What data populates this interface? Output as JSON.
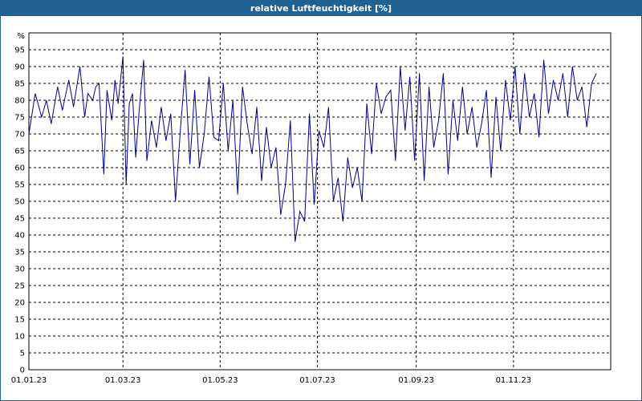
{
  "window": {
    "title": "relative Luftfeuchtigkeit [%]"
  },
  "chart_data": {
    "type": "line",
    "title": "relative Luftfeuchtigkeit [%]",
    "ylabel": "%",
    "ylim": [
      0,
      100
    ],
    "yticks": [
      0,
      5,
      10,
      15,
      20,
      25,
      30,
      35,
      40,
      45,
      50,
      55,
      60,
      65,
      70,
      75,
      80,
      85,
      90,
      95
    ],
    "xlim": [
      "2023-01-01",
      "2024-01-01"
    ],
    "xticks": [
      {
        "date": "2023-01-01",
        "label": "01.01.23"
      },
      {
        "date": "2023-03-01",
        "label": "01.03.23"
      },
      {
        "date": "2023-05-01",
        "label": "01.05.23"
      },
      {
        "date": "2023-07-01",
        "label": "01.07.23"
      },
      {
        "date": "2023-09-01",
        "label": "01.09.23"
      },
      {
        "date": "2023-11-01",
        "label": "01.11.23"
      }
    ],
    "grid": true,
    "line_color": "#00008b",
    "series": [
      {
        "x": [
          "2023-01-01",
          "2023-01-05",
          "2023-01-09",
          "2023-01-12",
          "2023-01-15",
          "2023-01-19",
          "2023-01-22",
          "2023-01-26",
          "2023-01-29",
          "2023-02-02",
          "2023-02-05",
          "2023-02-07",
          "2023-02-10",
          "2023-02-12",
          "2023-02-14",
          "2023-02-17",
          "2023-02-19",
          "2023-02-22",
          "2023-02-24",
          "2023-02-26",
          "2023-03-01",
          "2023-03-03",
          "2023-03-05",
          "2023-03-07",
          "2023-03-09",
          "2023-03-11",
          "2023-03-14",
          "2023-03-16",
          "2023-03-19",
          "2023-03-22",
          "2023-03-25",
          "2023-03-28",
          "2023-03-31",
          "2023-04-03",
          "2023-04-06",
          "2023-04-09",
          "2023-04-12",
          "2023-04-15",
          "2023-04-18",
          "2023-04-21",
          "2023-04-24",
          "2023-04-27",
          "2023-04-30",
          "2023-05-03",
          "2023-05-06",
          "2023-05-09",
          "2023-05-12",
          "2023-05-15",
          "2023-05-18",
          "2023-05-21",
          "2023-05-24",
          "2023-05-27",
          "2023-05-30",
          "2023-06-02",
          "2023-06-05",
          "2023-06-08",
          "2023-06-11",
          "2023-06-14",
          "2023-06-17",
          "2023-06-20",
          "2023-06-23",
          "2023-06-26",
          "2023-06-29",
          "2023-07-02",
          "2023-07-05",
          "2023-07-08",
          "2023-07-11",
          "2023-07-14",
          "2023-07-17",
          "2023-07-20",
          "2023-07-23",
          "2023-07-26",
          "2023-07-29",
          "2023-08-01",
          "2023-08-04",
          "2023-08-07",
          "2023-08-10",
          "2023-08-13",
          "2023-08-16",
          "2023-08-19",
          "2023-08-22",
          "2023-08-25",
          "2023-08-28",
          "2023-08-31",
          "2023-09-03",
          "2023-09-06",
          "2023-09-09",
          "2023-09-12",
          "2023-09-15",
          "2023-09-18",
          "2023-09-21",
          "2023-09-24",
          "2023-09-27",
          "2023-09-30",
          "2023-10-03",
          "2023-10-06",
          "2023-10-09",
          "2023-10-12",
          "2023-10-15",
          "2023-10-18",
          "2023-10-21",
          "2023-10-24",
          "2023-10-27",
          "2023-10-30",
          "2023-11-02",
          "2023-11-05",
          "2023-11-08",
          "2023-11-11",
          "2023-11-14",
          "2023-11-17",
          "2023-11-20",
          "2023-11-23",
          "2023-11-26",
          "2023-11-29",
          "2023-12-02",
          "2023-12-05",
          "2023-12-08",
          "2023-12-11",
          "2023-12-14",
          "2023-12-17",
          "2023-12-20",
          "2023-12-23"
        ],
        "y": [
          70,
          82,
          75,
          80,
          73,
          84,
          77,
          86,
          78,
          90,
          75,
          82,
          80,
          84,
          85,
          58,
          83,
          74,
          86,
          79,
          93,
          55,
          79,
          82,
          63,
          76,
          92,
          62,
          74,
          66,
          78,
          68,
          76,
          50,
          71,
          89,
          61,
          83,
          60,
          70,
          87,
          69,
          68,
          85,
          65,
          80,
          52,
          84,
          73,
          64,
          78,
          56,
          72,
          60,
          66,
          46,
          55,
          74,
          38,
          47,
          44,
          76,
          49,
          71,
          66,
          78,
          50,
          57,
          44,
          63,
          54,
          60,
          50,
          79,
          64,
          85,
          76,
          81,
          83,
          62,
          90,
          71,
          87,
          62,
          88,
          56,
          84,
          66,
          74,
          88,
          58,
          80,
          68,
          84,
          70,
          78,
          66,
          73,
          83,
          57,
          81,
          65,
          86,
          74,
          90,
          70,
          88,
          75,
          82,
          69,
          92,
          76,
          86,
          80,
          88,
          75,
          90,
          80,
          84,
          72,
          85,
          88
        ]
      }
    ]
  }
}
